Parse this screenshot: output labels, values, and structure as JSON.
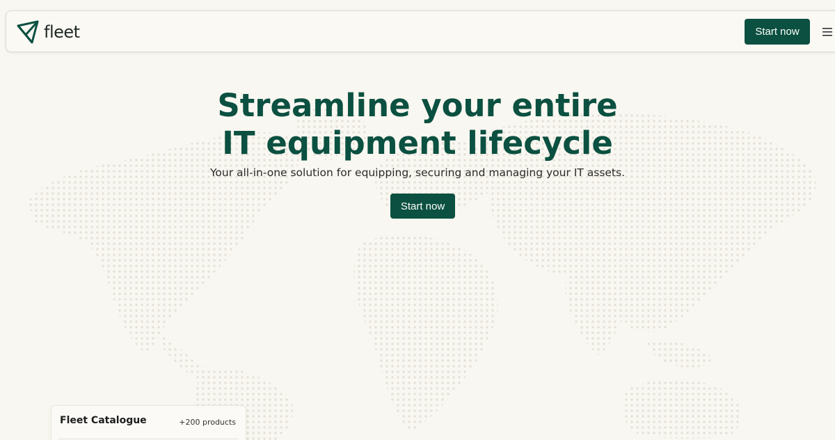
{
  "header": {
    "logo_text": "fleet",
    "cta_label": "Start now",
    "menu_icon": "hamburger-menu-icon"
  },
  "hero": {
    "title_line1": "Streamline your entire",
    "title_line2": "IT equipment lifecycle",
    "subtitle": "Your all-in-one solution for equipping, securing and managing your IT assets.",
    "cta_label": "Start now"
  },
  "catalogue": {
    "title": "Fleet Catalogue",
    "count": "+200 products"
  },
  "colors": {
    "brand": "#0b5040",
    "background": "#f9f7f1",
    "map_dots": "#e6e3da"
  }
}
